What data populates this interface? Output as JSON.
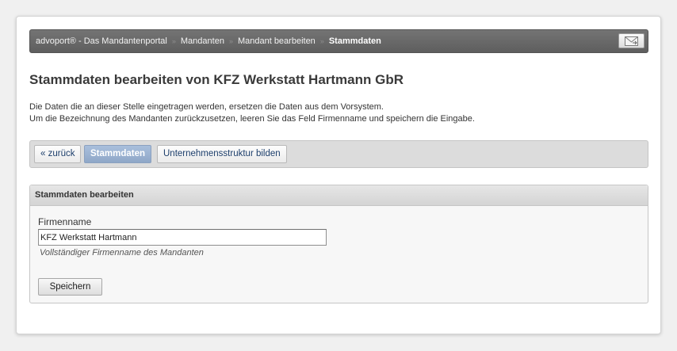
{
  "breadcrumb": {
    "items": [
      {
        "label": "advoport® - Das Mandantenportal"
      },
      {
        "label": "Mandanten"
      },
      {
        "label": "Mandant bearbeiten"
      },
      {
        "label": "Stammdaten"
      }
    ],
    "separator": "»"
  },
  "header": {
    "mail_icon": "mail-icon"
  },
  "page": {
    "title": "Stammdaten bearbeiten von KFZ Werkstatt Hartmann GbR",
    "description_line1": "Die Daten die an dieser Stelle eingetragen werden, ersetzen die Daten aus dem Vorsystem.",
    "description_line2": "Um die Bezeichnung des Mandanten zurückzusetzen, leeren Sie das Feld Firmenname und speichern die Eingabe."
  },
  "tabs": {
    "back": "« zurück",
    "stammdaten": "Stammdaten",
    "struktur": "Unternehmensstruktur bilden"
  },
  "form": {
    "panel_title": "Stammdaten bearbeiten",
    "firmenname_label": "Firmenname",
    "firmenname_value": "KFZ Werkstatt Hartmann",
    "firmenname_hint": "Vollständiger Firmenname des Mandanten",
    "save_label": "Speichern"
  },
  "colors": {
    "topbar": "#666666",
    "active_tab": "#9db3d3",
    "link_text": "#1c3e6b"
  }
}
